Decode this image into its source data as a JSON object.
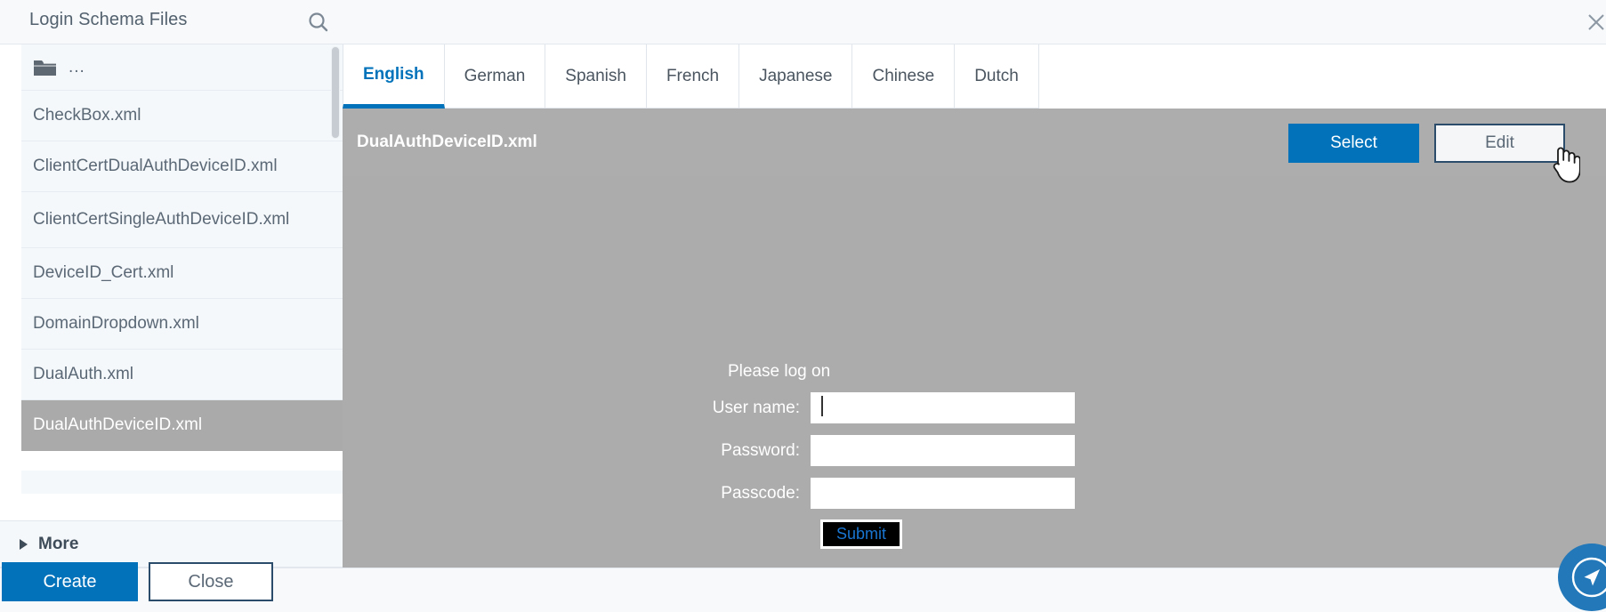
{
  "window": {
    "title": "Login Schema Files",
    "close_icon": "close-x-icon",
    "search_icon": "search-icon"
  },
  "sidebar": {
    "parent_folder": {
      "icon": "folder-icon",
      "label": "..."
    },
    "files": [
      {
        "name": "CheckBox.xml",
        "selected": false,
        "size": "std"
      },
      {
        "name": "ClientCertDualAuthDeviceID.xml",
        "selected": false,
        "size": "std"
      },
      {
        "name": "ClientCertSingleAuthDeviceID.xml",
        "selected": false,
        "size": "tall"
      },
      {
        "name": "DeviceID_Cert.xml",
        "selected": false,
        "size": "std"
      },
      {
        "name": "DomainDropdown.xml",
        "selected": false,
        "size": "std"
      },
      {
        "name": "DualAuth.xml",
        "selected": false,
        "size": "std"
      },
      {
        "name": "DualAuthDeviceID.xml",
        "selected": true,
        "size": "std"
      }
    ],
    "more": {
      "label": "More",
      "caret_icon": "caret-right-icon"
    }
  },
  "main": {
    "tabs": [
      {
        "label": "English",
        "active": true
      },
      {
        "label": "German",
        "active": false
      },
      {
        "label": "Spanish",
        "active": false
      },
      {
        "label": "French",
        "active": false
      },
      {
        "label": "Japanese",
        "active": false
      },
      {
        "label": "Chinese",
        "active": false
      },
      {
        "label": "Dutch",
        "active": false
      }
    ],
    "panel": {
      "filename": "DualAuthDeviceID.xml",
      "select_label": "Select",
      "edit_label": "Edit"
    },
    "login_form": {
      "title": "Please log on",
      "fields": [
        {
          "label": "User name:",
          "value": "",
          "placeholder": "",
          "focused": true
        },
        {
          "label": "Password:",
          "value": "",
          "placeholder": "",
          "focused": false
        },
        {
          "label": "Passcode:",
          "value": "",
          "placeholder": "",
          "focused": false
        }
      ],
      "submit_label": "Submit"
    }
  },
  "footer": {
    "create_label": "Create",
    "close_label": "Close"
  },
  "fab": {
    "icon": "navigation-arrow-icon"
  },
  "colors": {
    "accent_blue": "#0273bb",
    "panel_gray": "#acacac",
    "selected_gray": "#aaaaaa",
    "sidebar_bg": "#f5f8fa",
    "border_dark": "#2b4c6b",
    "submit_bg": "#000000",
    "submit_text": "#1976d2"
  }
}
